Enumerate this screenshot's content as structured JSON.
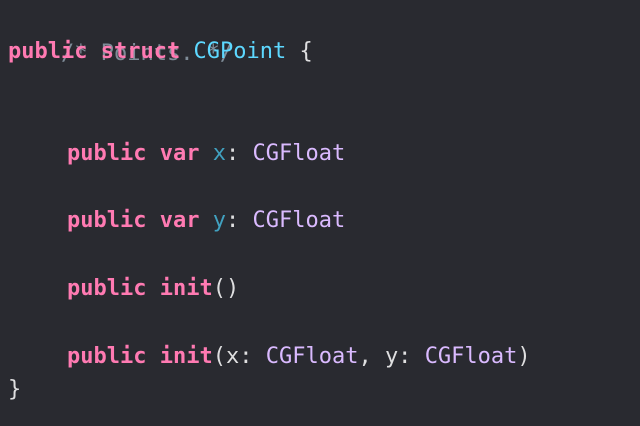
{
  "colors": {
    "background": "#292a30",
    "keyword": "#ff7ab2",
    "type_declaration": "#5dd8ff",
    "type_reference": "#dabaff",
    "property": "#41a1c0",
    "comment": "#7f8c98",
    "plain": "#dfdfe0"
  },
  "code": {
    "comment": "/* Points. */",
    "struct_decl": {
      "kw_public": "public",
      "kw_struct": "struct",
      "name": "CGPoint",
      "open_brace": "{"
    },
    "var_x": {
      "kw_public": "public",
      "kw_var": "var",
      "name": "x",
      "colon": ":",
      "type": "CGFloat"
    },
    "var_y": {
      "kw_public": "public",
      "kw_var": "var",
      "name": "y",
      "colon": ":",
      "type": "CGFloat"
    },
    "init_empty": {
      "kw_public": "public",
      "kw_init": "init",
      "parens": "()"
    },
    "init_xy": {
      "kw_public": "public",
      "kw_init": "init",
      "open_paren": "(",
      "param1_label": "x: ",
      "param1_type": "CGFloat",
      "separator": ", ",
      "param2_label": "y: ",
      "param2_type": "CGFloat",
      "close_paren": ")"
    },
    "close_brace": "}"
  }
}
